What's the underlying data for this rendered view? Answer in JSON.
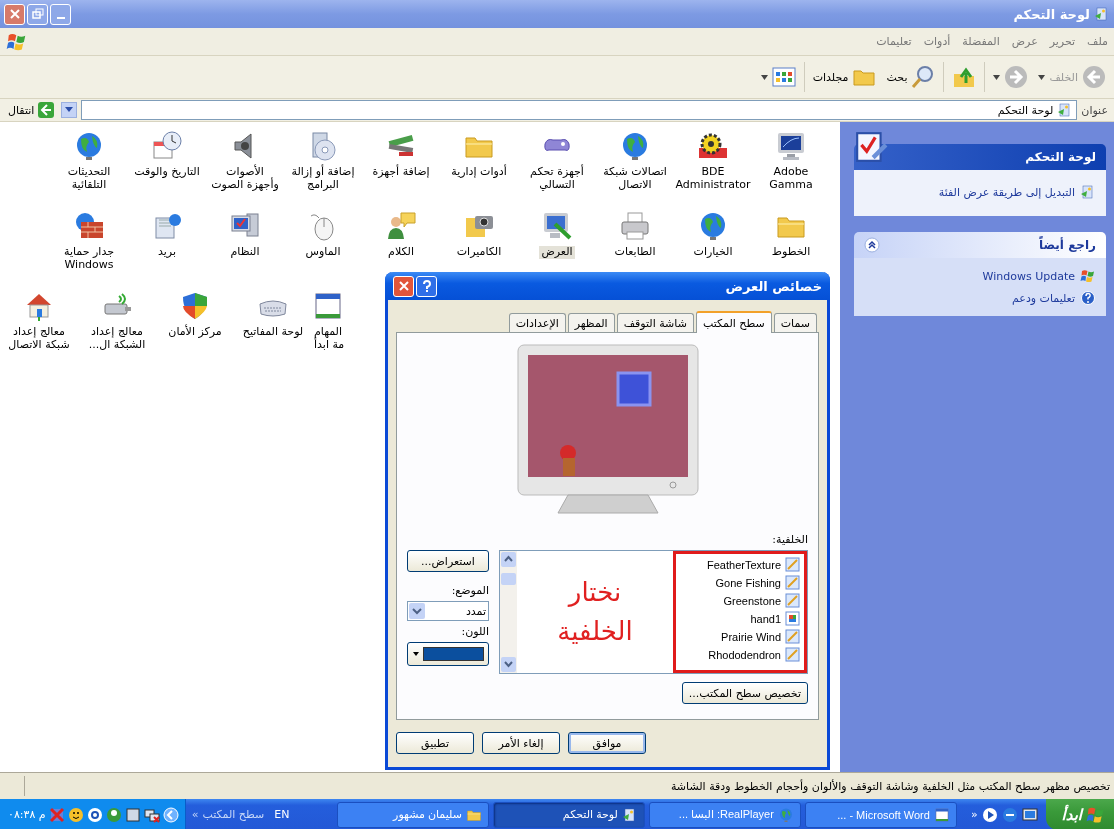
{
  "window": {
    "title": "لوحة التحكم"
  },
  "menu": [
    "ملف",
    "تحرير",
    "عرض",
    "المفضلة",
    "أدوات",
    "تعليمات"
  ],
  "toolbar": {
    "back": "الخلف",
    "search": "بحث",
    "folders": "مجلدات"
  },
  "address": {
    "label": "عنوان",
    "value": "لوحة التحكم",
    "go": "انتقال"
  },
  "task_pane": [
    {
      "title": "لوحة التحكم",
      "kind": "primary",
      "links": [
        "التبديل إلى طريقة عرض الفئة"
      ]
    },
    {
      "title": "راجع أيضاً",
      "kind": "secondary",
      "links": [
        "Windows Update",
        "تعليمات ودعم"
      ]
    }
  ],
  "icon_rows": [
    [
      {
        "label": "Adobe Gamma",
        "selected": false
      },
      {
        "label": "BDE\nAdministrator",
        "selected": false
      },
      {
        "label": "اتصالات شبكة\nالاتصال",
        "selected": false
      },
      {
        "label": "أجهزة تحكم\nالتسالي",
        "selected": false
      },
      {
        "label": "أدوات إدارية",
        "selected": false
      },
      {
        "label": "إضافة أجهزة",
        "selected": false
      },
      {
        "label": "إضافة أو إزالة\nالبرامج",
        "selected": false
      },
      {
        "label": "الأصوات\nوأجهزة الصوت",
        "selected": false
      },
      {
        "label": "التاريخ والوقت",
        "selected": false
      },
      {
        "label": "التحديثات\nالتلقائية",
        "selected": false
      }
    ],
    [
      {
        "label": "الخطوط",
        "selected": false
      },
      {
        "label": "الخيارات",
        "selected": false
      },
      {
        "label": "الطابعات",
        "selected": false
      },
      {
        "label": "العرض",
        "selected": true
      },
      {
        "label": "الكاميرات",
        "selected": false
      },
      {
        "label": "الكلام",
        "selected": false
      },
      {
        "label": "الماوس",
        "selected": false
      },
      {
        "label": "النظام",
        "selected": false
      },
      {
        "label": "بريد",
        "selected": false
      },
      {
        "label": "جدار حماية\nWindows",
        "selected": false
      }
    ],
    [
      {
        "label": "المهام\nمة ابدأ",
        "selected": false
      },
      {
        "label": "لوحة المفاتيح",
        "selected": false
      },
      {
        "label": "مركز الأمان",
        "selected": false
      },
      {
        "label": "معالج إعداد\nالشبكة ال...",
        "selected": false
      },
      {
        "label": "معالج إعداد\nشبكة الاتصال",
        "selected": false
      }
    ]
  ],
  "dialog": {
    "title": "خصائص العرض",
    "tabs": [
      {
        "label": "سمات",
        "selected": false
      },
      {
        "label": "سطح المكتب",
        "selected": true
      },
      {
        "label": "شاشة التوقف",
        "selected": false
      },
      {
        "label": "المظهر",
        "selected": false
      },
      {
        "label": "الإعدادات",
        "selected": false
      }
    ],
    "background_label": "الخلفية:",
    "backgrounds": [
      {
        "name": "FeatherTexture",
        "kind": "picture"
      },
      {
        "name": "Gone Fishing",
        "kind": "picture"
      },
      {
        "name": "Greenstone",
        "kind": "picture"
      },
      {
        "name": "hand1",
        "kind": "bitmap"
      },
      {
        "name": "Prairie Wind",
        "kind": "picture"
      },
      {
        "name": "Rhododendron",
        "kind": "picture"
      }
    ],
    "annotation": [
      "نختار",
      "الخلفية"
    ],
    "browse": "استعراض...",
    "position_label": "الموضع:",
    "position": "تمدد",
    "color_label": "اللون:",
    "color": "#0b4f9e",
    "customize": "تخصيص سطح المكتب...",
    "buttons": [
      {
        "label": "موافق",
        "default": true
      },
      {
        "label": "إلغاء الأمر",
        "default": false
      },
      {
        "label": "تطبيق",
        "default": false
      }
    ]
  },
  "status_bar": "تخصيص مظهر سطح المكتب مثل الخلفية وشاشة التوقف والألوان وأحجام الخطوط ودقة الشاشة",
  "taskbar": {
    "start": "ابدأ",
    "quick_launch_more": "«",
    "tasks": [
      {
        "label": "Microsoft Word - ...",
        "selected": false
      },
      {
        "label": "RealPlayer: البسا ...",
        "selected": false
      },
      {
        "label": "لوحة التحكم",
        "selected": true
      },
      {
        "label": "سليمان مشهور",
        "selected": false
      }
    ],
    "language": "EN",
    "toolbar_label": "سطح المكتب",
    "toolbar_more": "»",
    "clock": "م ٠٨:٣٨"
  }
}
